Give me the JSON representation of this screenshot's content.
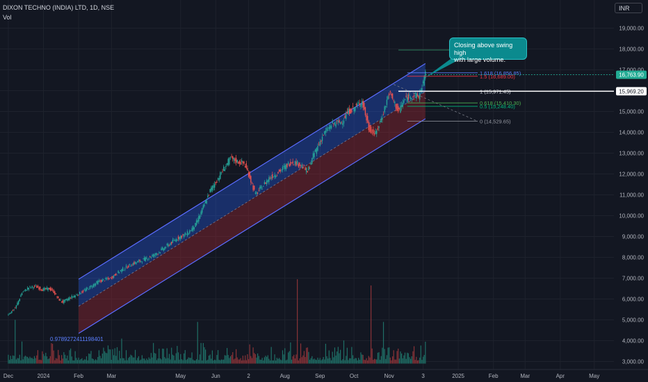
{
  "header": {
    "symbol_line": "DIXON TECHNO (INDIA) LTD, 1D, NSE",
    "volume_label": "Vol",
    "currency": "INR"
  },
  "annotation": {
    "line1": "Closing above swing high",
    "line2": "with large volume."
  },
  "regression_label": "0.9789272411198401",
  "price_badges": {
    "last_price": "16,763.90",
    "marked_level": "15,969.20"
  },
  "colors": {
    "background": "#131722",
    "bull": "#26a69a",
    "bear": "#ef5350",
    "channel_upper_fill": "#2962ff",
    "channel_lower_fill": "#b22833",
    "channel_line": "#5b6cff",
    "callout": "#0b8a8e"
  },
  "chart_data": {
    "type": "candlestick",
    "symbol": "DIXON TECHNO (INDIA) LTD",
    "interval": "1D",
    "exchange": "NSE",
    "currency": "INR",
    "ylim": [
      2800,
      19700
    ],
    "y_ticks": [
      "19,000.00",
      "18,000.00",
      "17,000.00",
      "16,000.00",
      "15,000.00",
      "14,000.00",
      "13,000.00",
      "12,000.00",
      "11,000.00",
      "10,000.00",
      "9,000.00",
      "8,000.00",
      "7,000.00",
      "6,000.00",
      "5,000.00",
      "4,000.00",
      "3,000.00"
    ],
    "y_tick_values": [
      19000,
      18000,
      17000,
      16000,
      15000,
      14000,
      13000,
      12000,
      11000,
      10000,
      9000,
      8000,
      7000,
      6000,
      5000,
      4000,
      3000
    ],
    "x_ticks": [
      "Dec",
      "2024",
      "Feb",
      "Mar",
      "May",
      "Jun",
      "2",
      "Aug",
      "Sep",
      "Oct",
      "Nov",
      "3",
      "2025",
      "Feb",
      "Mar",
      "Apr",
      "May"
    ],
    "x_tick_days": [
      0,
      31,
      62,
      91,
      152,
      183,
      212,
      244,
      275,
      305,
      336,
      366,
      397,
      428,
      456,
      487,
      517
    ],
    "last_data_day": 368,
    "price_path": [
      [
        0,
        5280
      ],
      [
        6,
        5550
      ],
      [
        12,
        6300
      ],
      [
        18,
        6550
      ],
      [
        24,
        6600
      ],
      [
        30,
        6450
      ],
      [
        36,
        6500
      ],
      [
        40,
        6350
      ],
      [
        44,
        6000
      ],
      [
        48,
        5850
      ],
      [
        54,
        6050
      ],
      [
        62,
        6250
      ],
      [
        70,
        6500
      ],
      [
        80,
        6850
      ],
      [
        90,
        7000
      ],
      [
        100,
        7400
      ],
      [
        110,
        7700
      ],
      [
        120,
        7900
      ],
      [
        130,
        8150
      ],
      [
        140,
        8550
      ],
      [
        150,
        8950
      ],
      [
        158,
        9150
      ],
      [
        165,
        9550
      ],
      [
        172,
        10400
      ],
      [
        178,
        11200
      ],
      [
        184,
        11700
      ],
      [
        190,
        12250
      ],
      [
        196,
        12750
      ],
      [
        202,
        12600
      ],
      [
        208,
        12500
      ],
      [
        212,
        12000
      ],
      [
        218,
        11000
      ],
      [
        224,
        11400
      ],
      [
        230,
        11800
      ],
      [
        236,
        12000
      ],
      [
        242,
        12250
      ],
      [
        250,
        12600
      ],
      [
        258,
        12450
      ],
      [
        264,
        12100
      ],
      [
        270,
        13000
      ],
      [
        278,
        13900
      ],
      [
        286,
        14400
      ],
      [
        294,
        14500
      ],
      [
        300,
        15000
      ],
      [
        306,
        15200
      ],
      [
        312,
        15500
      ],
      [
        318,
        14200
      ],
      [
        324,
        13900
      ],
      [
        330,
        14800
      ],
      [
        336,
        15900
      ],
      [
        340,
        15500
      ],
      [
        344,
        15000
      ],
      [
        350,
        15600
      ],
      [
        356,
        15800
      ],
      [
        362,
        15700
      ],
      [
        368,
        16763.9
      ]
    ],
    "volume": {
      "axis": "overlay bottom",
      "spikes": [
        {
          "day": 6,
          "value": 5000
        },
        {
          "day": 100,
          "value": 4100
        },
        {
          "day": 167,
          "value": 4900
        },
        {
          "day": 255,
          "value": 6950
        },
        {
          "day": 320,
          "value": 6650
        },
        {
          "day": 331,
          "value": 4900
        },
        {
          "day": 368,
          "value": 3950
        }
      ]
    },
    "regression_channel": {
      "start_day": 62,
      "end_day": 368,
      "upper": [
        6950,
        17300
      ],
      "middle": [
        5650,
        15950
      ],
      "lower": [
        4350,
        14650
      ],
      "pearson_r": 0.9789272411198401
    },
    "fibonacci": [
      {
        "label": "1.618 (16,856.85)",
        "value": 16856.85,
        "color": "#5b7fff"
      },
      {
        "label": "1.5 (16,689.00)",
        "value": 16689.0,
        "color": "#f23645"
      },
      {
        "label": "1 (15,971.45)",
        "value": 15971.45,
        "color": "#d1d4dc"
      },
      {
        "label": "0.618 (15,410.30)",
        "value": 15410.3,
        "color": "#4caf50"
      },
      {
        "label": "0.5 (15,248.40)",
        "value": 15248.4,
        "color": "#00b57a"
      },
      {
        "label": "0 (14,529.65)",
        "value": 14529.65,
        "color": "#9598a1"
      }
    ],
    "horizontal_lines": [
      {
        "value": 17950,
        "color": "#2e7d5b"
      },
      {
        "value": 15969.2,
        "color": "#ffffff"
      }
    ],
    "last_price": 16763.9,
    "marked_level": 15969.2
  }
}
